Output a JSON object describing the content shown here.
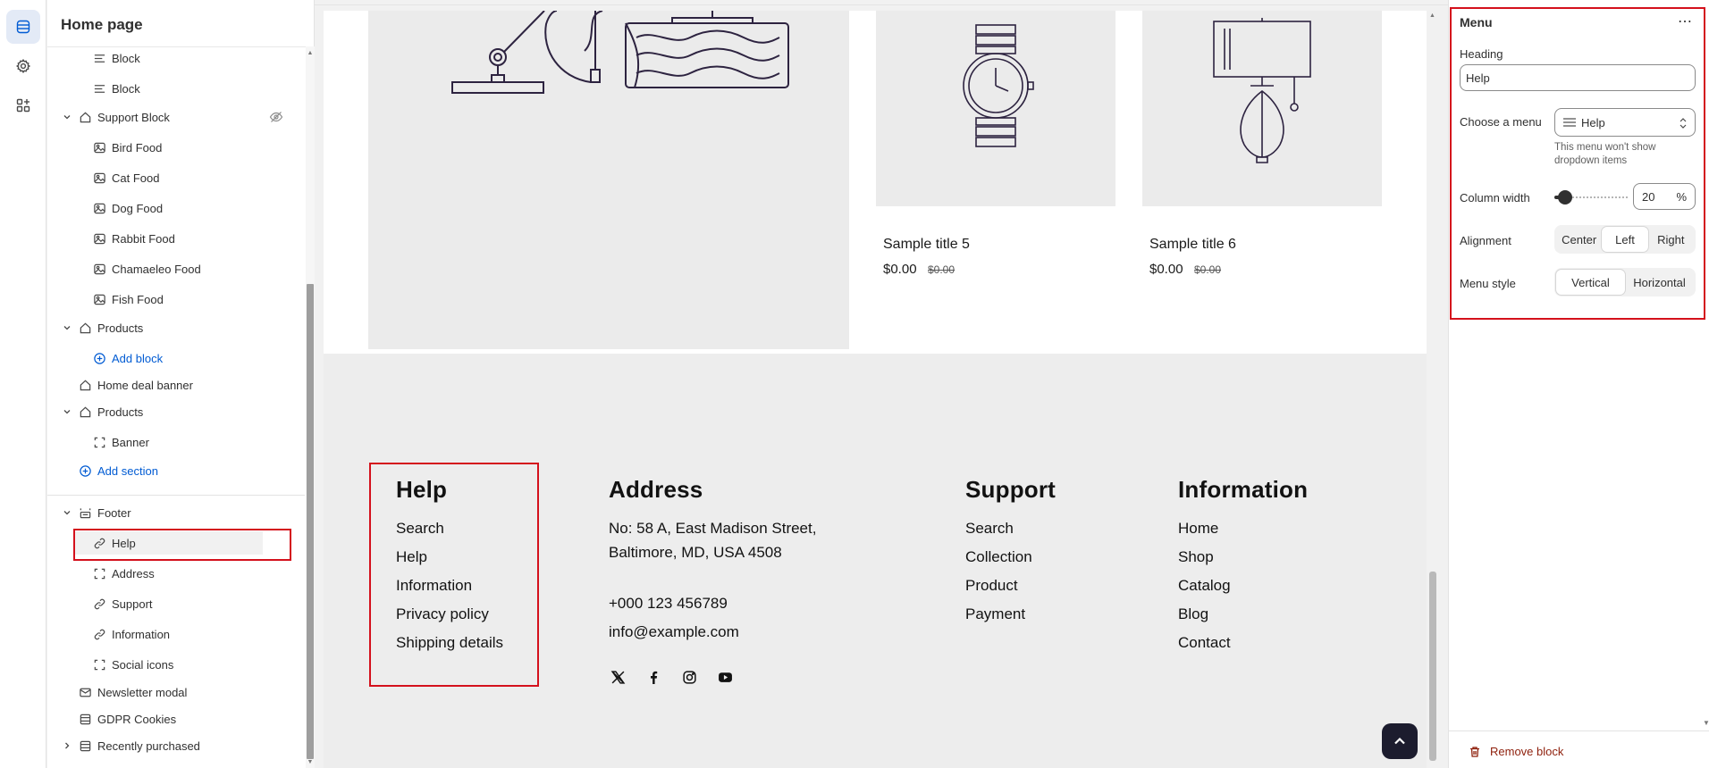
{
  "sidebar": {
    "title": "Home page",
    "items": [
      {
        "label": "Block",
        "icon": "text-lines-icon"
      },
      {
        "label": "Block",
        "icon": "text-lines-icon"
      },
      {
        "label": "Support Block",
        "icon": "section-icon"
      },
      {
        "label": "Bird Food",
        "icon": "image-icon"
      },
      {
        "label": "Cat Food",
        "icon": "image-icon"
      },
      {
        "label": "Dog Food",
        "icon": "image-icon"
      },
      {
        "label": "Rabbit Food",
        "icon": "image-icon"
      },
      {
        "label": "Chamaeleo Food",
        "icon": "image-icon"
      },
      {
        "label": "Fish Food",
        "icon": "image-icon"
      },
      {
        "label": "Products",
        "icon": "section-icon"
      },
      {
        "label": "Add block",
        "icon": "plus-circle-icon"
      },
      {
        "label": "Home deal banner",
        "icon": "section-icon"
      },
      {
        "label": "Products",
        "icon": "section-icon"
      },
      {
        "label": "Banner",
        "icon": "frame-icon"
      },
      {
        "label": "Add section",
        "icon": "plus-circle-icon"
      },
      {
        "label": "Footer",
        "icon": "footer-icon"
      },
      {
        "label": "Help",
        "icon": "link-icon"
      },
      {
        "label": "Address",
        "icon": "frame-icon"
      },
      {
        "label": "Support",
        "icon": "link-icon"
      },
      {
        "label": "Information",
        "icon": "link-icon"
      },
      {
        "label": "Social icons",
        "icon": "frame-icon"
      },
      {
        "label": "Newsletter modal",
        "icon": "modal-icon"
      },
      {
        "label": "GDPR Cookies",
        "icon": "section-list-icon"
      },
      {
        "label": "Recently purchased",
        "icon": "section-list-icon"
      }
    ]
  },
  "canvas": {
    "products": [
      {
        "title": "Sample title 5",
        "price": "$0.00",
        "compare_price": "$0.00"
      },
      {
        "title": "Sample title 6",
        "price": "$0.00",
        "compare_price": "$0.00"
      }
    ],
    "footer": {
      "help": {
        "heading": "Help",
        "links": [
          "Search",
          "Help",
          "Information",
          "Privacy policy",
          "Shipping details"
        ]
      },
      "address": {
        "heading": "Address",
        "line1": "No: 58 A, East Madison Street,",
        "line2": "Baltimore, MD, USA 4508",
        "phone": "+000 123 456789",
        "email": "info@example.com"
      },
      "support": {
        "heading": "Support",
        "links": [
          "Search",
          "Collection",
          "Product",
          "Payment"
        ]
      },
      "information": {
        "heading": "Information",
        "links": [
          "Home",
          "Shop",
          "Catalog",
          "Blog",
          "Contact"
        ]
      },
      "social_icons": [
        "x-icon",
        "facebook-icon",
        "instagram-icon",
        "youtube-icon"
      ]
    }
  },
  "panel": {
    "title": "Menu",
    "more": "⋯",
    "heading_label": "Heading",
    "heading_value": "Help",
    "choose_menu_label": "Choose a menu",
    "choose_menu_value": "Help",
    "menu_help_text": "This menu won't show dropdown items",
    "column_width_label": "Column width",
    "column_width_value": "20",
    "column_width_unit": "%",
    "alignment_label": "Alignment",
    "alignment_options": [
      "Center",
      "Left",
      "Right"
    ],
    "alignment_selected": "Left",
    "menu_style_label": "Menu style",
    "menu_style_options": [
      "Vertical",
      "Horizontal"
    ],
    "menu_style_selected": "Vertical",
    "remove_label": "Remove block"
  },
  "colors": {
    "accent_blue": "#005bd3",
    "highlight_red": "#d4111c",
    "remove_red": "#8e1f0b"
  }
}
